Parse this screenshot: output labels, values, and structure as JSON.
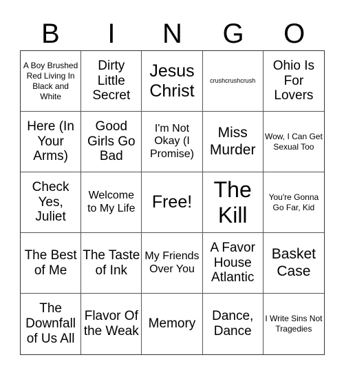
{
  "header": [
    "B",
    "I",
    "N",
    "G",
    "O"
  ],
  "cells": [
    "A Boy Brushed Red Living In Black and White",
    "Dirty Little Secret",
    "Jesus Christ",
    "crushcrushcrush",
    "Ohio Is For Lovers",
    "Here (In Your Arms)",
    "Good Girls Go Bad",
    "I'm Not Okay (I Promise)",
    "Miss Murder",
    "Wow, I Can Get Sexual Too",
    "Check Yes, Juliet",
    "Welcome to My Life",
    "Free!",
    "The Kill",
    "You're Gonna Go Far, Kid",
    "The Best of Me",
    "The Taste of Ink",
    "My Friends Over You",
    "A Favor House Atlantic",
    "Basket Case",
    "The Downfall of Us All",
    "Flavor Of the Weak",
    "Memory",
    "Dance, Dance",
    "I Write Sins Not Tragedies"
  ]
}
